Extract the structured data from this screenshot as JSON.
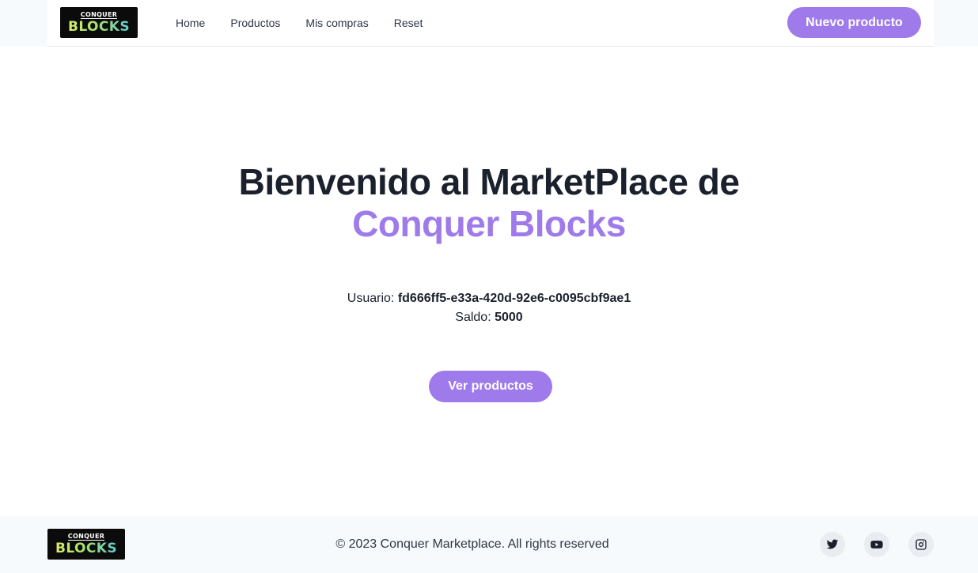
{
  "header": {
    "logo": {
      "top": "CONQUER",
      "bottom": "BLOCKS"
    },
    "nav": [
      "Home",
      "Productos",
      "Mis compras",
      "Reset"
    ],
    "new_product_label": "Nuevo producto"
  },
  "hero": {
    "title_line1": "Bienvenido al MarketPlace de",
    "title_line2": "Conquer Blocks",
    "user_label": "Usuario:",
    "user_id": "fd666ff5-e33a-420d-92e6-c0095cbf9ae1",
    "balance_label": "Saldo:",
    "balance_value": "5000",
    "view_products_label": "Ver productos"
  },
  "footer": {
    "logo": {
      "top": "CONQUER",
      "bottom": "BLOCKS"
    },
    "copyright": "© 2023 Conquer Marketplace. All rights reserved",
    "social_icons": [
      "twitter-icon",
      "youtube-icon",
      "instagram-icon"
    ]
  },
  "colors": {
    "accent": "#9f7aea",
    "text": "#1a202c",
    "band": "#f7fafc"
  }
}
